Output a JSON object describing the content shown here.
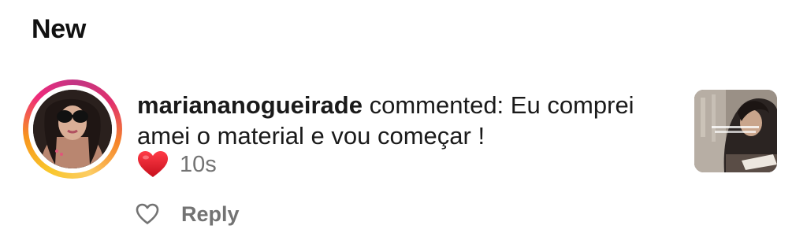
{
  "section": {
    "title": "New"
  },
  "notification": {
    "username": "mariananogueirade",
    "action_text": " commented: Eu comprei amei o material e vou começar !",
    "timestamp": "10s",
    "reply_label": "Reply",
    "avatar": {
      "icon": "user-avatar",
      "story_ring": true
    },
    "reaction_icon": "red-heart-emoji",
    "like_icon": "heart-outline-icon"
  },
  "colors": {
    "heart_red": "#e0202c",
    "muted_text": "#737373",
    "ring_gradient": [
      "#f9c62a",
      "#f7931e",
      "#ee2a7b",
      "#c13584"
    ]
  }
}
